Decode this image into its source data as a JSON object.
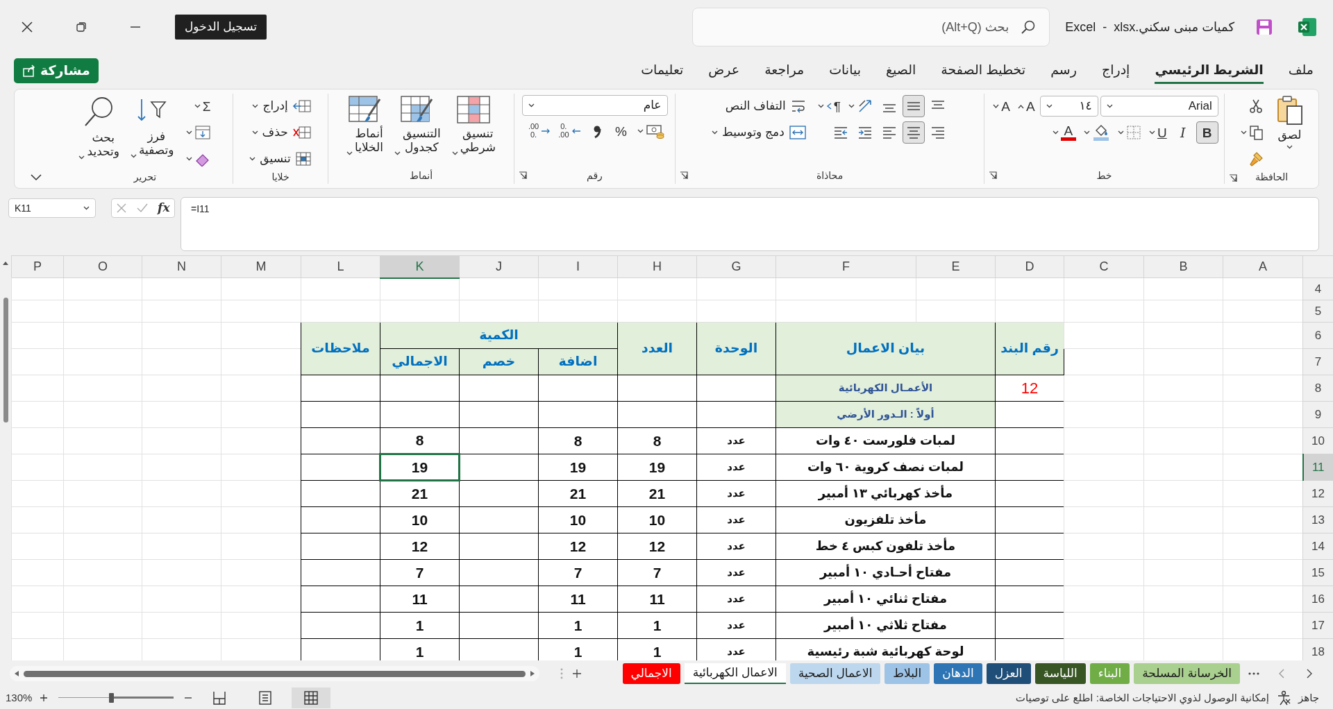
{
  "title_bar": {
    "file_name": "كميات مبنى سكني.xlsx",
    "separator": "-",
    "app_name": "Excel",
    "search": {
      "placeholder": "بحث (Alt+Q)"
    },
    "sign_in": "تسجيل الدخول"
  },
  "menu_tabs": [
    {
      "label": "ملف",
      "selected": false
    },
    {
      "label": "الشريط الرئيسي",
      "selected": true
    },
    {
      "label": "إدراج",
      "selected": false
    },
    {
      "label": "رسم",
      "selected": false
    },
    {
      "label": "تخطيط الصفحة",
      "selected": false
    },
    {
      "label": "الصيغ",
      "selected": false
    },
    {
      "label": "بيانات",
      "selected": false
    },
    {
      "label": "مراجعة",
      "selected": false
    },
    {
      "label": "عرض",
      "selected": false
    },
    {
      "label": "تعليمات",
      "selected": false
    }
  ],
  "share_button": "مشاركة",
  "ribbon": {
    "groups": [
      {
        "title": "الحافظة",
        "launcher": true,
        "columns": [
          {
            "kind": "big",
            "label": "لصق",
            "dropdown": true
          },
          {
            "kind": "stack",
            "rows": [
              [
                {
                  "kind": "tool",
                  "pressed": false,
                  "dropdown": false
                }
              ],
              [
                {
                  "kind": "tool",
                  "pressed": false,
                  "dropdown": true
                }
              ],
              [
                {
                  "kind": "tool",
                  "pressed": false,
                  "dropdown": false
                }
              ]
            ]
          }
        ]
      },
      {
        "title": "خط",
        "launcher": true,
        "columns": [
          {
            "kind": "stack",
            "rows": [
              [
                {
                  "kind": "select",
                  "value": "Arial"
                },
                {
                  "kind": "select",
                  "value": "١٤"
                },
                {
                  "kind": "tool",
                  "text": "A",
                  "pressed": false,
                  "dropdown": false
                },
                {
                  "kind": "tool",
                  "text": "A",
                  "pressed": false,
                  "dropdown": false
                }
              ],
              [
                {
                  "kind": "tool",
                  "text": "B",
                  "pressed": true,
                  "dropdown": false
                },
                {
                  "kind": "tool",
                  "text": "I",
                  "pressed": false,
                  "dropdown": false
                },
                {
                  "kind": "tool",
                  "text": "U",
                  "pressed": false,
                  "dropdown": true
                },
                {
                  "kind": "tool",
                  "pressed": false,
                  "dropdown": true
                },
                {
                  "kind": "tool",
                  "pressed": false,
                  "dropdown": true
                },
                {
                  "kind": "tool",
                  "text": "A",
                  "pressed": false,
                  "dropdown": true
                }
              ]
            ]
          }
        ]
      },
      {
        "title": "محاذاة",
        "launcher": true,
        "columns": [
          {
            "kind": "stack",
            "rows": [
              [
                {
                  "kind": "tool",
                  "pressed": false,
                  "dropdown": false
                },
                {
                  "kind": "tool",
                  "pressed": true,
                  "dropdown": false
                },
                {
                  "kind": "tool",
                  "pressed": false,
                  "dropdown": false
                },
                {
                  "kind": "tool",
                  "pressed": false,
                  "dropdown": true
                },
                {
                  "kind": "tool",
                  "text": "¶",
                  "pressed": false,
                  "dropdown": true
                }
              ],
              [
                {
                  "kind": "tool",
                  "pressed": false,
                  "dropdown": false
                },
                {
                  "kind": "tool",
                  "pressed": true,
                  "dropdown": false
                },
                {
                  "kind": "tool",
                  "pressed": false,
                  "dropdown": false
                },
                {
                  "kind": "tool",
                  "pressed": false,
                  "dropdown": false
                },
                {
                  "kind": "tool",
                  "pressed": false,
                  "dropdown": false
                }
              ]
            ]
          },
          {
            "kind": "stack",
            "rows": [
              [
                {
                  "kind": "labeled",
                  "label": "التفاف النص",
                  "dropdown": false
                }
              ],
              [
                {
                  "kind": "labeled",
                  "label": "دمج وتوسيط",
                  "dropdown": true
                }
              ]
            ]
          }
        ]
      },
      {
        "title": "رقم",
        "launcher": true,
        "columns": [
          {
            "kind": "stack",
            "rows": [
              [
                {
                  "kind": "select",
                  "value": "عام"
                }
              ],
              [
                {
                  "kind": "tool",
                  "pressed": false,
                  "dropdown": true
                },
                {
                  "kind": "tool",
                  "text": "%",
                  "pressed": false,
                  "dropdown": false
                },
                {
                  "kind": "tool",
                  "pressed": false,
                  "dropdown": false
                },
                {
                  "kind": "tool",
                  "lines": [
                    "0.",
                    ".00"
                  ],
                  "pressed": false,
                  "dropdown": false
                },
                {
                  "kind": "tool",
                  "lines": [
                    ".00",
                    "0."
                  ],
                  "pressed": false,
                  "dropdown": false
                }
              ]
            ]
          }
        ]
      },
      {
        "title": "أنماط",
        "launcher": false,
        "columns": [
          {
            "kind": "big",
            "label": "تنسيق شرطي",
            "dropdown": true
          },
          {
            "kind": "big",
            "label": "التنسيق كجدول",
            "dropdown": true
          },
          {
            "kind": "big",
            "label": "أنماط الخلايا",
            "dropdown": true
          }
        ]
      },
      {
        "title": "خلايا",
        "launcher": false,
        "columns": [
          {
            "kind": "stack",
            "rows": [
              [
                {
                  "kind": "labeled",
                  "label": "إدراج",
                  "dropdown": true
                }
              ],
              [
                {
                  "kind": "labeled",
                  "label": "حذف",
                  "dropdown": true
                }
              ],
              [
                {
                  "kind": "labeled",
                  "label": "تنسيق",
                  "dropdown": true
                }
              ]
            ]
          }
        ]
      },
      {
        "title": "تحرير",
        "launcher": false,
        "columns": [
          {
            "kind": "stack",
            "rows": [
              [
                {
                  "kind": "tool",
                  "text": "Σ",
                  "pressed": false,
                  "dropdown": true
                }
              ],
              [
                {
                  "kind": "tool",
                  "pressed": false,
                  "dropdown": true
                }
              ],
              [
                {
                  "kind": "tool",
                  "pressed": false,
                  "dropdown": true
                }
              ]
            ]
          },
          {
            "kind": "big",
            "label": "فرز وتصفية",
            "dropdown": true
          },
          {
            "kind": "big",
            "label": "بحث وتحديد",
            "dropdown": true
          }
        ]
      }
    ]
  },
  "formula_bar": {
    "name_box": "K11",
    "fx": "fx",
    "formula": "=I11"
  },
  "columns": [
    {
      "label": "A",
      "selected": false
    },
    {
      "label": "B",
      "selected": false
    },
    {
      "label": "C",
      "selected": false
    },
    {
      "label": "D",
      "selected": false
    },
    {
      "label": "E",
      "selected": false
    },
    {
      "label": "F",
      "selected": false
    },
    {
      "label": "G",
      "selected": false
    },
    {
      "label": "H",
      "selected": false
    },
    {
      "label": "I",
      "selected": false
    },
    {
      "label": "J",
      "selected": false
    },
    {
      "label": "K",
      "selected": true
    },
    {
      "label": "L",
      "selected": false
    },
    {
      "label": "M",
      "selected": false
    },
    {
      "label": "N",
      "selected": false
    },
    {
      "label": "O",
      "selected": false
    },
    {
      "label": "P",
      "selected": false
    }
  ],
  "rows": [
    {
      "label": "4",
      "selected": false
    },
    {
      "label": "5",
      "selected": false
    },
    {
      "label": "6",
      "selected": false
    },
    {
      "label": "7",
      "selected": false
    },
    {
      "label": "8",
      "selected": false
    },
    {
      "label": "9",
      "selected": false
    },
    {
      "label": "10",
      "selected": false
    },
    {
      "label": "11",
      "selected": true
    },
    {
      "label": "12",
      "selected": false
    },
    {
      "label": "13",
      "selected": false
    },
    {
      "label": "14",
      "selected": false
    },
    {
      "label": "15",
      "selected": false
    },
    {
      "label": "16",
      "selected": false
    },
    {
      "label": "17",
      "selected": false
    },
    {
      "label": "18",
      "selected": false
    }
  ],
  "table": {
    "headers": {
      "item_no": "رقم البند",
      "description": "بيان الاعمال",
      "unit": "الوحدة",
      "count": "العدد",
      "quantity": "الكمية",
      "addition": "اضافة",
      "deduction": "خصم",
      "total": "الاجمالي",
      "notes": "ملاحظات"
    },
    "section": {
      "item_no": "12",
      "title": "الأعمـال الكهربائية"
    },
    "subsection": "أولاً : الـدور الأرضي",
    "items": [
      {
        "description": "لمبات فلورست ٤٠ وات",
        "unit": "عدد",
        "count": "8",
        "addition": "8",
        "total": "8",
        "selected": false
      },
      {
        "description": "لمبات نصف كروية ٦٠ وات",
        "unit": "عدد",
        "count": "19",
        "addition": "19",
        "total": "19",
        "selected": true
      },
      {
        "description": "مأخذ كهربائي ١٣ أمبير",
        "unit": "عدد",
        "count": "21",
        "addition": "21",
        "total": "21",
        "selected": false
      },
      {
        "description": "مأخذ تلفزيون",
        "unit": "عدد",
        "count": "10",
        "addition": "10",
        "total": "10",
        "selected": false
      },
      {
        "description": "مأخذ تلفون كبس ٤ خط",
        "unit": "عدد",
        "count": "12",
        "addition": "12",
        "total": "12",
        "selected": false
      },
      {
        "description": "مفتاح أحـادي ١٠ أمبير",
        "unit": "عدد",
        "count": "7",
        "addition": "7",
        "total": "7",
        "selected": false
      },
      {
        "description": "مفتاح ثنائي ١٠ أمبير",
        "unit": "عدد",
        "count": "11",
        "addition": "11",
        "total": "11",
        "selected": false
      },
      {
        "description": "مفتاح ثلاثي ١٠ أمبير",
        "unit": "عدد",
        "count": "1",
        "addition": "1",
        "total": "1",
        "selected": false
      },
      {
        "description": "لوحة كهربائية شبة رئيسية",
        "unit": "عدد",
        "count": "1",
        "addition": "1",
        "total": "1",
        "selected": false
      }
    ]
  },
  "sheet_tabs": [
    {
      "label": "الخرسانة المسلحة",
      "color": "#a9d08e",
      "selected": false
    },
    {
      "label": "البناء",
      "color": "#70ad47",
      "selected": false
    },
    {
      "label": "اللياسة",
      "color": "#375623",
      "selected": false
    },
    {
      "label": "العزل",
      "color": "#1f4e78",
      "selected": false
    },
    {
      "label": "الدهان",
      "color": "#2e75b6",
      "selected": false
    },
    {
      "label": "البلاط",
      "color": "#9dc3e6",
      "selected": false
    },
    {
      "label": "الاعمال الصحية",
      "color": "#bdd7ee",
      "selected": false
    },
    {
      "label": "الاعمال الكهربائية",
      "selected": true
    },
    {
      "label": "الاجمالي",
      "color": "#ff0000",
      "selected": false
    }
  ],
  "status_bar": {
    "ready": "جاهز",
    "accessibility": "إمكانية الوصول لذوي الاحتياجات الخاصة: اطلع على توصيات",
    "views": [
      {
        "selected": true
      },
      {
        "selected": false
      },
      {
        "selected": false
      }
    ],
    "zoom": {
      "level": 0.54,
      "reading": "130%"
    }
  }
}
